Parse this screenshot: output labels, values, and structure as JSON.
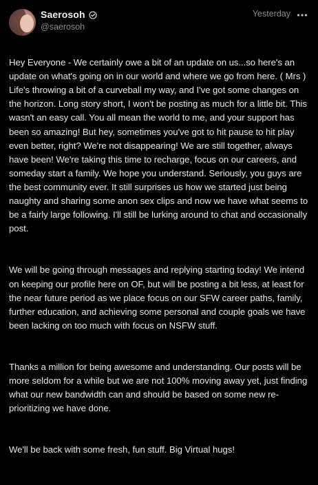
{
  "post": {
    "display_name": "Saerosoh",
    "username": "@saerosoh",
    "timestamp": "Yesterday",
    "icons": {
      "verified": "verified-check-icon",
      "more": "more-dots-icon"
    },
    "paragraphs": [
      "Hey Everyone - We certainly owe a bit of an update on us...so here's an update on what's going on in our world and where we go from here. ( Mrs ) Life's throwing a bit of a curveball my way, and I've got some changes on the horizon. Long story short, I won't be posting as much for a little bit. This wasn't an easy call. You all mean the world to me, and your support has been so amazing! But hey, sometimes you've got to hit pause to hit play even better, right? We're not disappearing! We are still together, always have been! We're taking this time to recharge, focus on our careers, and someday start a family. We hope you understand. Seriously, you guys are the best community ever. It still surprises us how we started just being naughty and sharing some anon sex clips and now we have what seems to be a fairly large following. I'll still be lurking around to chat and occasionally post.",
      "We will be going through messages and replying starting today! We intend on keeping our profile here on OF, but will be posting a bit less, at least for the near future period as we place focus on our SFW career paths, family, further education, and achieving some personal and couple goals we have been lacking on too much with focus on NSFW stuff.",
      "Thanks a million for being awesome and understanding. Our posts will be more seldom for a while but we are not 100% moving away yet, just finding what our new bandwidth can and should be based on some new re-prioritizing we have done.",
      "We'll be back with some fresh, fun stuff. Big Virtual hugs!"
    ]
  }
}
